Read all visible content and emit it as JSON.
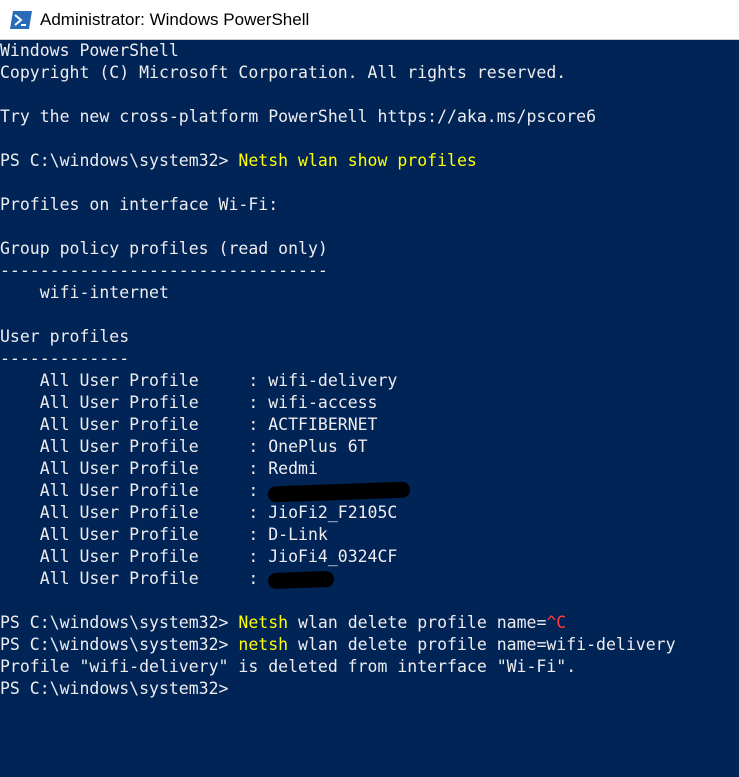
{
  "window": {
    "title": "Administrator: Windows PowerShell",
    "icon": "powershell-icon"
  },
  "colors": {
    "background": "#012456",
    "text": "#eeedf0",
    "command": "#ffff00",
    "interrupt": "#ff3b3b"
  },
  "console": {
    "header_line1": "Windows PowerShell",
    "header_line2": "Copyright (C) Microsoft Corporation. All rights reserved.",
    "tip_line": "Try the new cross-platform PowerShell https://aka.ms/pscore6",
    "prompt": "PS C:\\windows\\system32> ",
    "command1": "Netsh wlan show profiles",
    "profiles_heading": "Profiles on interface Wi-Fi:",
    "group_policy_heading": "Group policy profiles (read only)",
    "group_policy_rule": "---------------------------------",
    "group_policy_profile": "    wifi-internet",
    "user_profiles_heading": "User profiles",
    "user_profiles_rule": "-------------",
    "user_profiles": [
      {
        "label": "    All User Profile     : ",
        "name": "wifi-delivery"
      },
      {
        "label": "    All User Profile     : ",
        "name": "wifi-access"
      },
      {
        "label": "    All User Profile     : ",
        "name": "ACTFIBERNET"
      },
      {
        "label": "    All User Profile     : ",
        "name": "OnePlus 6T"
      },
      {
        "label": "    All User Profile     : ",
        "name": "Redmi"
      },
      {
        "label": "    All User Profile     : ",
        "name": ""
      },
      {
        "label": "    All User Profile     : ",
        "name": "JioFi2_F2105C"
      },
      {
        "label": "    All User Profile     : ",
        "name": "D-Link"
      },
      {
        "label": "    All User Profile     : ",
        "name": "JioFi4_0324CF"
      },
      {
        "label": "    All User Profile     : ",
        "name": ""
      }
    ],
    "command2": "Netsh",
    "command2_rest": " wlan delete profile name=",
    "command2_interrupt": "^C",
    "command3": "netsh",
    "command3_rest": " wlan delete profile name=wifi-delivery",
    "result_line": "Profile \"wifi-delivery\" is deleted from interface \"Wi-Fi\"."
  }
}
